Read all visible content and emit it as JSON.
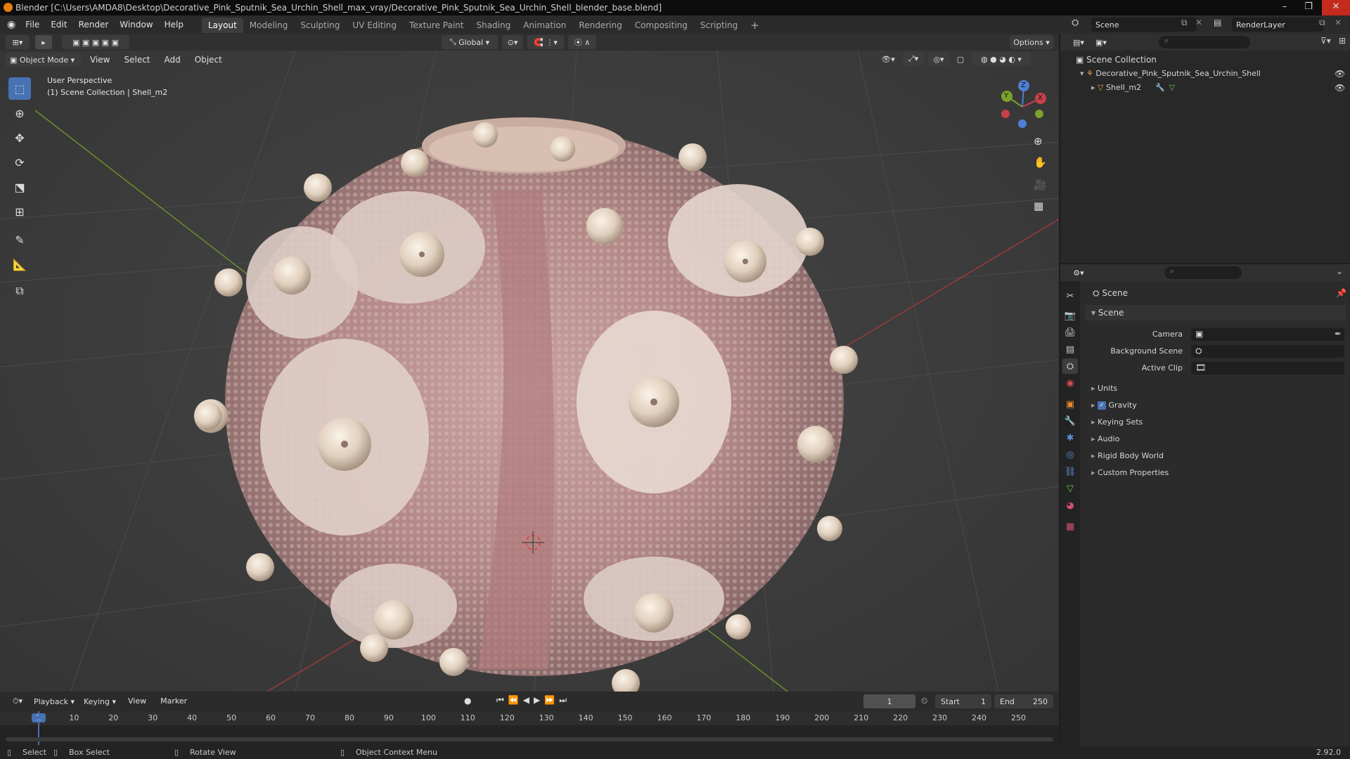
{
  "window": {
    "title": "Blender [C:\\Users\\AMDA8\\Desktop\\Decorative_Pink_Sputnik_Sea_Urchin_Shell_max_vray/Decorative_Pink_Sputnik_Sea_Urchin_Shell_blender_base.blend]"
  },
  "menu": [
    "File",
    "Edit",
    "Render",
    "Window",
    "Help"
  ],
  "workspaces": [
    "Layout",
    "Modeling",
    "Sculpting",
    "UV Editing",
    "Texture Paint",
    "Shading",
    "Animation",
    "Rendering",
    "Compositing",
    "Scripting"
  ],
  "workspace_add": "+",
  "scene_selector": {
    "value": "Scene"
  },
  "layer_selector": {
    "value": "RenderLayer"
  },
  "viewport_header": {
    "transform_orientation": "Global",
    "options": "Options",
    "mode": "Object Mode",
    "menus": [
      "View",
      "Select",
      "Add",
      "Object"
    ]
  },
  "viewport": {
    "perspective": "User Perspective",
    "collection_info": "(1) Scene Collection | Shell_m2",
    "gizmo": {
      "x": "X",
      "y": "Y",
      "z": "Z"
    }
  },
  "outliner": {
    "root": "Scene Collection",
    "collection": "Decorative_Pink_Sputnik_Sea_Urchin_Shell",
    "object": "Shell_m2"
  },
  "properties": {
    "header": "Scene",
    "panel": "Scene",
    "fields": [
      {
        "label": "Camera",
        "value": ""
      },
      {
        "label": "Background Scene",
        "value": ""
      },
      {
        "label": "Active Clip",
        "value": ""
      }
    ],
    "sections": [
      "Units",
      "Gravity",
      "Keying Sets",
      "Audio",
      "Rigid Body World",
      "Custom Properties"
    ],
    "gravity_checked": true
  },
  "timeline": {
    "menus": [
      "Playback",
      "Keying",
      "View",
      "Marker"
    ],
    "current_frame": "1",
    "start_label": "Start",
    "start": "1",
    "end_label": "End",
    "end": "250",
    "ruler": [
      "1",
      "10",
      "20",
      "30",
      "40",
      "50",
      "60",
      "70",
      "80",
      "90",
      "100",
      "110",
      "120",
      "130",
      "140",
      "150",
      "160",
      "170",
      "180",
      "190",
      "200",
      "210",
      "220",
      "230",
      "240",
      "250"
    ]
  },
  "status": {
    "select": "Select",
    "box_select": "Box Select",
    "rotate": "Rotate View",
    "context": "Object Context Menu",
    "version": "2.92.0"
  },
  "colors": {
    "accent": "#4772b3",
    "orange": "#e87d0d",
    "shell_pink": "#b08585",
    "knob": "#e8d9c8"
  }
}
